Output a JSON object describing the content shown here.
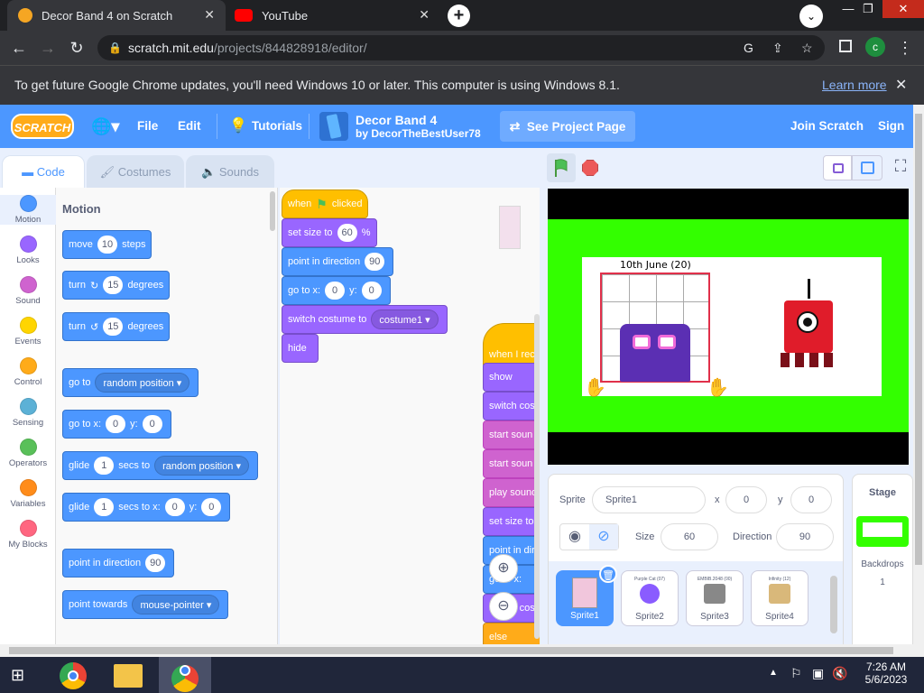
{
  "browser": {
    "tabs": [
      {
        "title": "Decor Band 4 on Scratch",
        "active": true
      },
      {
        "title": "YouTube",
        "active": false
      }
    ],
    "url_domain": "scratch.mit.edu",
    "url_path": "/projects/844828918/editor/",
    "profile_initial": "c",
    "infobar_text": "To get future Google Chrome updates, you'll need Windows 10 or later. This computer is using Windows 8.1.",
    "infobar_link": "Learn more"
  },
  "menubar": {
    "logo": "SCRATCH",
    "file": "File",
    "edit": "Edit",
    "tutorials": "Tutorials",
    "project_title": "Decor Band 4",
    "project_author": "by DecorTheBestUser78",
    "see_project": "See Project Page",
    "join": "Join Scratch",
    "signin": "Sign in"
  },
  "editor_tabs": {
    "code": "Code",
    "costumes": "Costumes",
    "sounds": "Sounds"
  },
  "categories": [
    {
      "label": "Motion",
      "color": "#4c97ff"
    },
    {
      "label": "Looks",
      "color": "#9966ff"
    },
    {
      "label": "Sound",
      "color": "#cf63cf"
    },
    {
      "label": "Events",
      "color": "#ffd500"
    },
    {
      "label": "Control",
      "color": "#ffab19"
    },
    {
      "label": "Sensing",
      "color": "#5cb1d6"
    },
    {
      "label": "Operators",
      "color": "#59c059"
    },
    {
      "label": "Variables",
      "color": "#ff8c1a"
    },
    {
      "label": "My Blocks",
      "color": "#ff6680"
    }
  ],
  "palette": {
    "heading": "Motion",
    "move": {
      "a": "move",
      "v": "10",
      "b": "steps"
    },
    "turn_cw": {
      "a": "turn",
      "v": "15",
      "b": "degrees"
    },
    "turn_ccw": {
      "a": "turn",
      "v": "15",
      "b": "degrees"
    },
    "goto": {
      "a": "go to",
      "d": "random position"
    },
    "goto_xy": {
      "a": "go to x:",
      "x": "0",
      "y_lbl": "y:",
      "y": "0"
    },
    "glide": {
      "a": "glide",
      "v": "1",
      "b": "secs to",
      "d": "random position"
    },
    "glide_xy": {
      "a": "glide",
      "v": "1",
      "b": "secs to x:",
      "x": "0",
      "y_lbl": "y:",
      "y": "0"
    },
    "point_dir": {
      "a": "point in direction",
      "v": "90"
    },
    "point_towards": {
      "a": "point towards",
      "d": "mouse-pointer"
    }
  },
  "script": {
    "when": "when",
    "clicked": "clicked",
    "set_size": {
      "a": "set size to",
      "v": "60",
      "b": "%"
    },
    "point_dir": {
      "a": "point in direction",
      "v": "90"
    },
    "goto_xy": {
      "a": "go to x:",
      "x": "0",
      "y_lbl": "y:",
      "y": "0"
    },
    "switch_costume": {
      "a": "switch costume to",
      "d": "costume1"
    },
    "hide": "hide",
    "stack2": [
      "when I rec",
      "show",
      "switch cos",
      "start soun",
      "start soun",
      "play sound",
      "set size to",
      "point in dire",
      "go to x:",
      "switch costu",
      "else"
    ]
  },
  "stage": {
    "board_text": "10th June (20)"
  },
  "sprite_info": {
    "sprite_lbl": "Sprite",
    "sprite_name": "Sprite1",
    "x_lbl": "x",
    "x": "0",
    "y_lbl": "y",
    "y": "0",
    "size_lbl": "Size",
    "size": "60",
    "dir_lbl": "Direction",
    "dir": "90",
    "show_lbl": "Show"
  },
  "sprites": [
    {
      "name": "Sprite1",
      "selected": true,
      "caption": ""
    },
    {
      "name": "Sprite2",
      "selected": false,
      "caption": "Purple Cat (07)"
    },
    {
      "name": "Sprite3",
      "selected": false,
      "caption": "EMBIB.2048 (00)"
    },
    {
      "name": "Sprite4",
      "selected": false,
      "caption": "Infinity (12)"
    }
  ],
  "stage_pane": {
    "title": "Stage",
    "backdrops_lbl": "Backdrops",
    "backdrops": "1"
  },
  "taskbar": {
    "time": "7:26 AM",
    "date": "5/6/2023"
  }
}
